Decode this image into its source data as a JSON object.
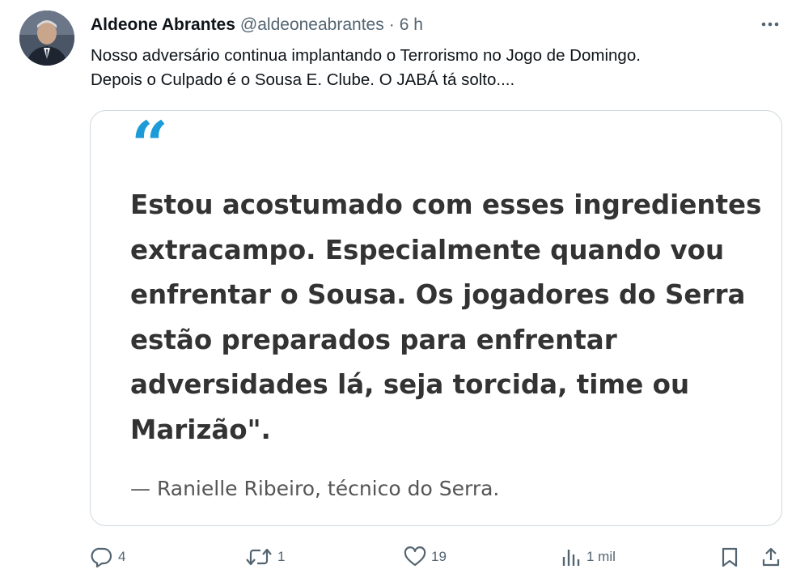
{
  "tweet": {
    "author_name": "Aldeone Abrantes",
    "handle": "@aldeoneabrantes",
    "separator": "·",
    "time": "6 h",
    "text_lines": [
      "Nosso adversário continua implantando o Terrorismo no Jogo de Domingo.",
      "Depois o Culpado é o Sousa E. Clube. O JABÁ tá solto...."
    ]
  },
  "card": {
    "quote_mark": "“",
    "quote_lines": [
      "Estou acostumado com esses ingredientes",
      "extracampo. Especialmente quando vou",
      "enfrentar o Sousa. Os jogadores do Serra",
      "estão preparados para enfrentar",
      "adversidades lá, seja torcida, time ou",
      "Marizão\"."
    ],
    "attribution": "— Ranielle Ribeiro, técnico do Serra."
  },
  "actions": {
    "replies": "4",
    "retweets": "1",
    "likes": "19",
    "views": "1 mil"
  },
  "colors": {
    "text": "#0f1419",
    "muted": "#536471",
    "quote_accent": "#1d9bd8",
    "card_border": "#cfd9de"
  },
  "icons": [
    "more-icon",
    "reply-icon",
    "retweet-icon",
    "like-icon",
    "views-icon",
    "bookmark-icon",
    "share-icon"
  ]
}
